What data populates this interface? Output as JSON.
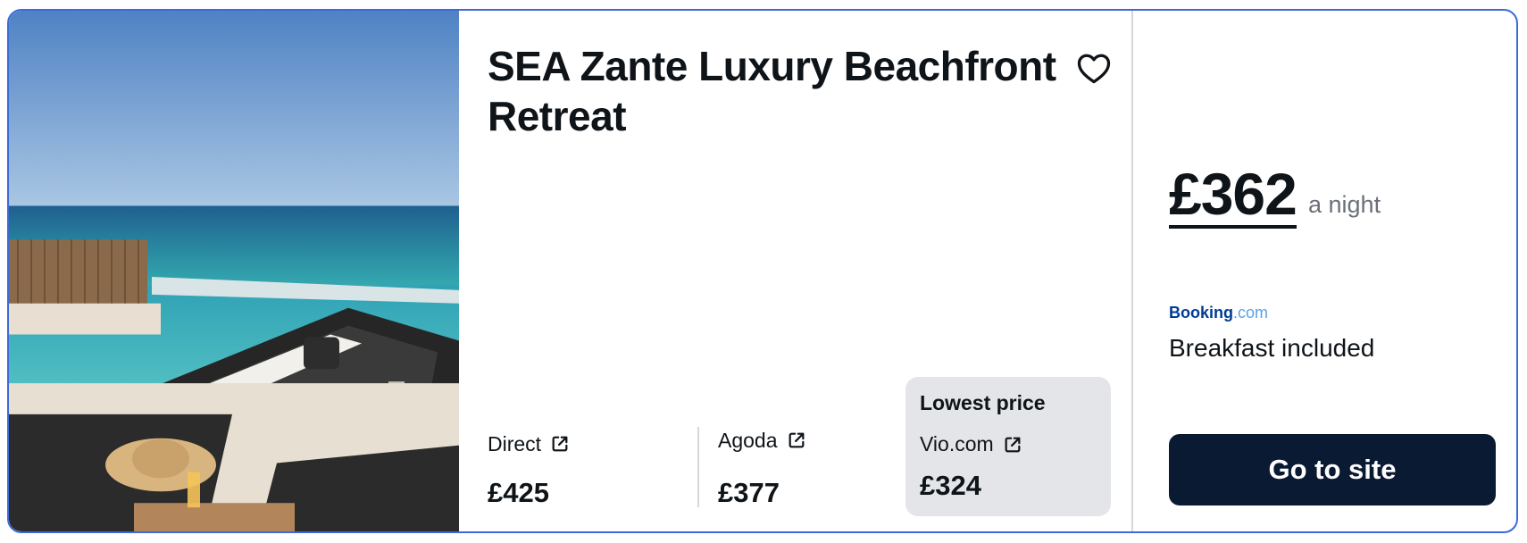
{
  "hotel": {
    "name": "SEA Zante Luxury Beachfront Retreat",
    "favorite_icon": "heart-outline-icon"
  },
  "providers": [
    {
      "name": "Direct",
      "price": "£425",
      "icon": "external-link-icon"
    },
    {
      "name": "Agoda",
      "price": "£377",
      "icon": "external-link-icon"
    }
  ],
  "lowest": {
    "tag": "Lowest price",
    "name": "Vio.com",
    "price": "£324",
    "icon": "external-link-icon"
  },
  "offer": {
    "price": "£362",
    "per": "a night",
    "logo_main": "Booking",
    "logo_suffix": ".com",
    "amenity": "Breakfast included",
    "cta": "Go to site"
  },
  "colors": {
    "card_border": "#3d6ad8",
    "cta_bg": "#0b1a33",
    "lowest_bg": "#e3e5e8",
    "booking_blue": "#003b95",
    "booking_dot": "#5aa2e8"
  }
}
